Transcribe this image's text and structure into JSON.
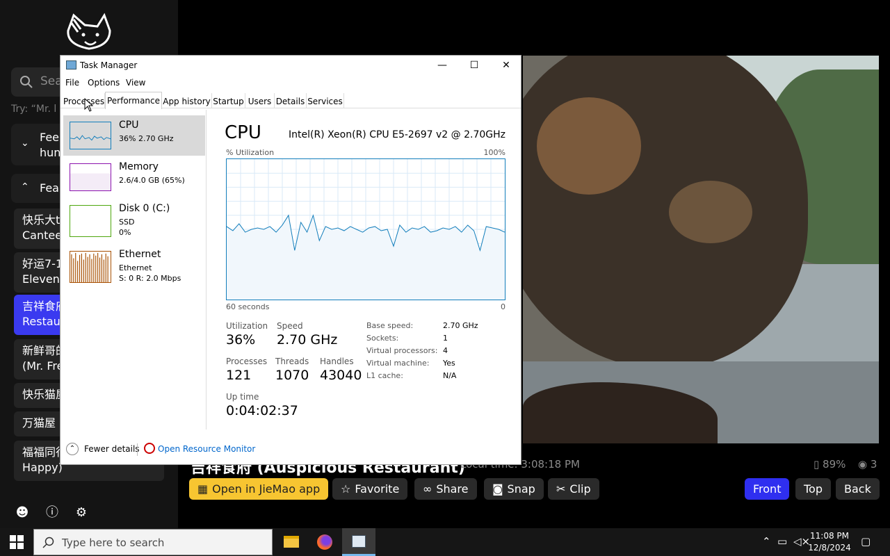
{
  "sidebar": {
    "search_placeholder": "Sea",
    "try_text": "Try: “Mr. l",
    "accordions": [
      {
        "chevron": "⌄",
        "label": "Fee\nhun"
      },
      {
        "chevron": "⌃",
        "label": "Fea"
      }
    ],
    "cameras": [
      {
        "line1": "快乐大t",
        "line2": "Cantee",
        "active": false
      },
      {
        "line1": "好运7-1",
        "line2": "Eleven",
        "active": false
      },
      {
        "line1": "吉祥食府",
        "line2": "Restau",
        "active": true
      },
      {
        "line1": "新鲜哥的",
        "line2": "(Mr. Fre",
        "active": false
      },
      {
        "line1": "快乐猫屋",
        "line2": "",
        "active": false
      },
      {
        "line1": "万猫屋",
        "line2": "",
        "active": false
      },
      {
        "line1": "福福同行",
        "line2": "Happy)",
        "active": false
      }
    ],
    "footer_icons": [
      "discord-icon",
      "info-icon",
      "settings-icon"
    ]
  },
  "camera": {
    "title": "吉祥食府 (Auspicious Restaurant)",
    "local_time": "Local time: 3:08:18 PM",
    "battery": "89%",
    "viewers": "3",
    "buttons": {
      "open_app": "Open in JieMao app",
      "favorite": "Favorite",
      "share": "Share",
      "snap": "Snap",
      "clip": "Clip",
      "front": "Front",
      "top": "Top",
      "back": "Back"
    }
  },
  "task_manager": {
    "title": "Task Manager",
    "menu": [
      "File",
      "Options",
      "View"
    ],
    "tabs": [
      "Processes",
      "Performance",
      "App history",
      "Startup",
      "Users",
      "Details",
      "Services"
    ],
    "selected_tab": "Performance",
    "resources": [
      {
        "name": "CPU",
        "sub1": "36% 2.70 GHz",
        "sub2": "",
        "sub3": ""
      },
      {
        "name": "Memory",
        "sub1": "2.6/4.0 GB (65%)",
        "sub2": "",
        "sub3": ""
      },
      {
        "name": "Disk 0 (C:)",
        "sub1": "SSD",
        "sub2": "0%",
        "sub3": ""
      },
      {
        "name": "Ethernet",
        "sub1": "Ethernet",
        "sub2": "S: 0 R: 2.0 Mbps",
        "sub3": ""
      }
    ],
    "perf": {
      "heading": "CPU",
      "model": "Intel(R) Xeon(R) CPU E5-2697 v2 @ 2.70GHz",
      "util_label": "% Utilization",
      "max_label": "100%",
      "time_label": "60 seconds",
      "zero_label": "0",
      "utilization_label": "Utilization",
      "utilization": "36%",
      "speed_label": "Speed",
      "speed": "2.70 GHz",
      "processes_label": "Processes",
      "processes": "121",
      "threads_label": "Threads",
      "threads": "1070",
      "handles_label": "Handles",
      "handles": "43040",
      "uptime_label": "Up time",
      "uptime": "0:04:02:37",
      "details": [
        {
          "k": "Base speed:",
          "v": "2.70 GHz"
        },
        {
          "k": "Sockets:",
          "v": "1"
        },
        {
          "k": "Virtual processors:",
          "v": "4"
        },
        {
          "k": "Virtual machine:",
          "v": "Yes"
        },
        {
          "k": "L1 cache:",
          "v": "N/A"
        }
      ],
      "cpu_history": [
        52,
        49,
        54,
        48,
        50,
        51,
        50,
        52,
        48,
        53,
        60,
        35,
        55,
        48,
        60,
        42,
        52,
        50,
        51,
        49,
        52,
        50,
        48,
        51,
        52,
        49,
        50,
        38,
        53,
        48,
        51,
        50,
        52,
        48,
        49,
        51,
        50,
        52,
        48,
        53,
        49,
        35,
        52,
        51,
        50,
        48
      ]
    },
    "fewer_details": "Fewer details",
    "resource_monitor": "Open Resource Monitor"
  },
  "taskbar": {
    "search_placeholder": "Type here to search",
    "time": "11:08 PM",
    "date": "12/8/2024"
  }
}
